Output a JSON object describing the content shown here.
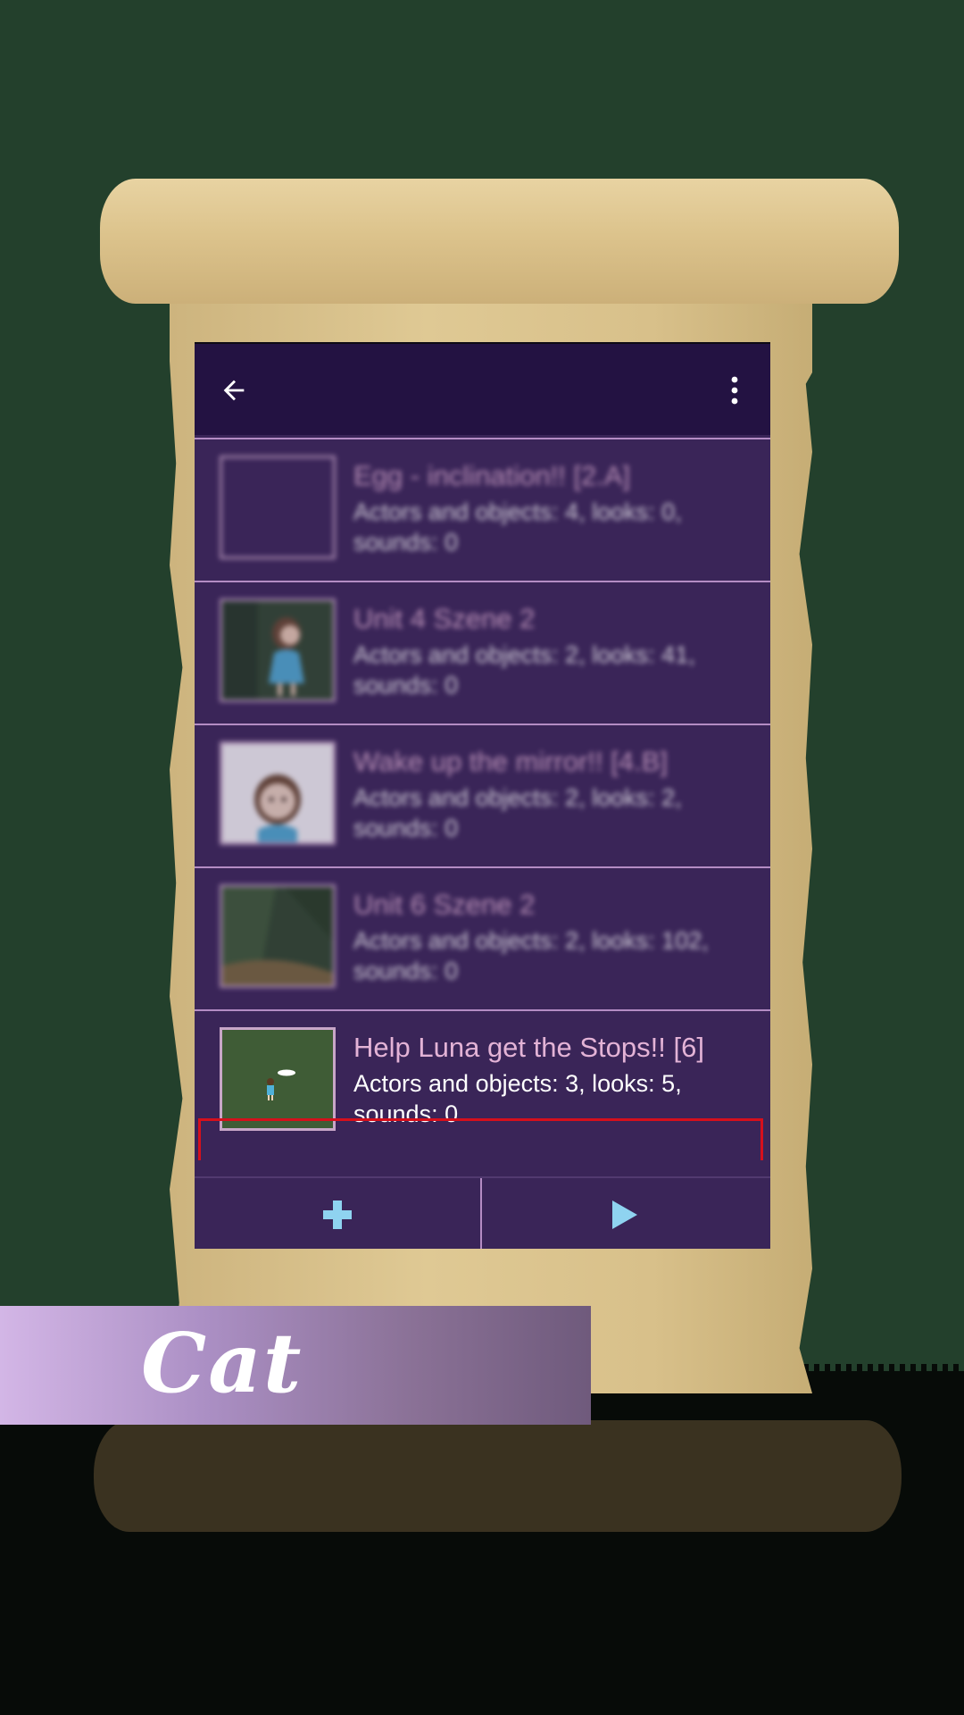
{
  "toolbar": {
    "back_icon": "arrow-left-icon",
    "menu_icon": "more-vert-icon"
  },
  "scenes": [
    {
      "title": "Egg - inclination!! [2.A]",
      "details": "Actors and objects: 4, looks: 0, sounds: 0",
      "blurred": true
    },
    {
      "title": "Unit 4 Szene 2",
      "details": "Actors and objects: 2, looks: 41, sounds: 0",
      "blurred": true
    },
    {
      "title": "Wake up the mirror!! [4.B]",
      "details": "Actors and objects: 2, looks: 2, sounds: 0",
      "blurred": true
    },
    {
      "title": "Unit 6 Szene 2",
      "details": "Actors and objects: 2, looks: 102, sounds: 0",
      "blurred": true
    },
    {
      "title": "Help Luna get the Stops!! [6]",
      "details": "Actors and objects: 3, looks: 5, sounds: 0",
      "blurred": false
    }
  ],
  "bottom_bar": {
    "add_icon": "plus-icon",
    "play_icon": "play-icon"
  },
  "banner": {
    "label": "Cat"
  },
  "colors": {
    "background": "#23402c",
    "toolbar": "#231242",
    "list": "#3a2558",
    "title_text": "#e3b3d6",
    "highlight": "#d6101c",
    "accent_icon": "#8fd3f0"
  }
}
